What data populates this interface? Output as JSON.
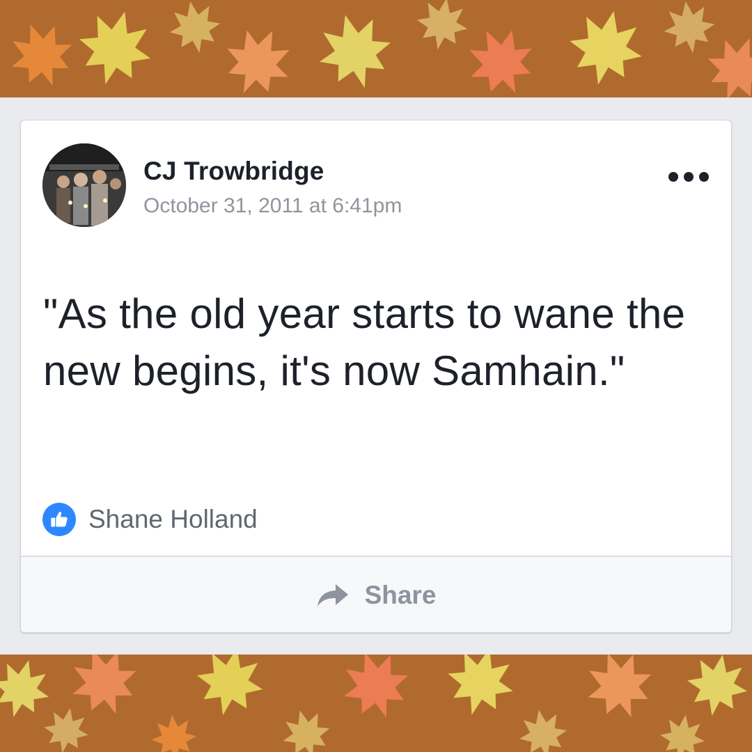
{
  "post": {
    "author": "CJ Trowbridge",
    "timestamp": "October 31, 2011 at 6:41pm",
    "text": "\"As the old year starts to wane the new begins, it's now Samhain.\"",
    "liked_by": "Shane Holland"
  },
  "actions": {
    "share_label": "Share"
  },
  "icons": {
    "more": "more-options-icon",
    "like": "thumbs-up-icon",
    "share": "share-arrow-icon"
  },
  "colors": {
    "background_pattern": "#b06a2e",
    "like_badge": "#2d88ff",
    "author_text": "#1d2129",
    "meta_text": "#90949c"
  }
}
